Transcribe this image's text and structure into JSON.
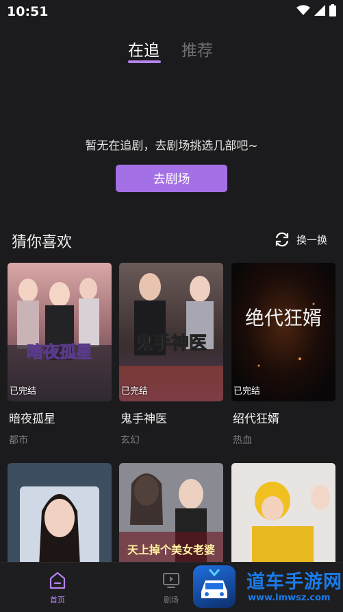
{
  "status_bar": {
    "time": "10:51"
  },
  "tabs": [
    {
      "label": "在追",
      "active": true
    },
    {
      "label": "推荐",
      "active": false
    }
  ],
  "empty_state": {
    "message": "暂无在追剧，去剧场挑选几部吧~",
    "button_label": "去剧场"
  },
  "recommend": {
    "title": "猜你喜欢",
    "refresh_label": "换一换",
    "cards": [
      {
        "title": "暗夜孤星",
        "genre": "都市",
        "status": "已完结",
        "poster_text": "暗夜孤星"
      },
      {
        "title": "鬼手神医",
        "genre": "玄幻",
        "status": "已完结",
        "poster_text": "鬼手神医"
      },
      {
        "title": "绍代狂婿",
        "genre": "热血",
        "status": "已完结",
        "poster_text": "绝代狂婿"
      },
      {
        "title": "",
        "genre": "",
        "status": "",
        "poster_text": ""
      },
      {
        "title": "",
        "genre": "",
        "status": "",
        "poster_text": "天上掉个美女老婆"
      },
      {
        "title": "",
        "genre": "",
        "status": "",
        "poster_text": ""
      }
    ]
  },
  "bottom_nav": {
    "items": [
      {
        "label": "首页",
        "icon": "home-icon",
        "active": true
      },
      {
        "label": "剧场",
        "icon": "play-screen-icon",
        "active": false
      }
    ]
  },
  "watermark": {
    "text": "道车手游网",
    "url": "www.lmwsz.com"
  },
  "colors": {
    "background": "#1b1b1d",
    "accent": "#a470e6",
    "tab_underline": "#b583ee",
    "muted_text": "#7b7b80"
  }
}
